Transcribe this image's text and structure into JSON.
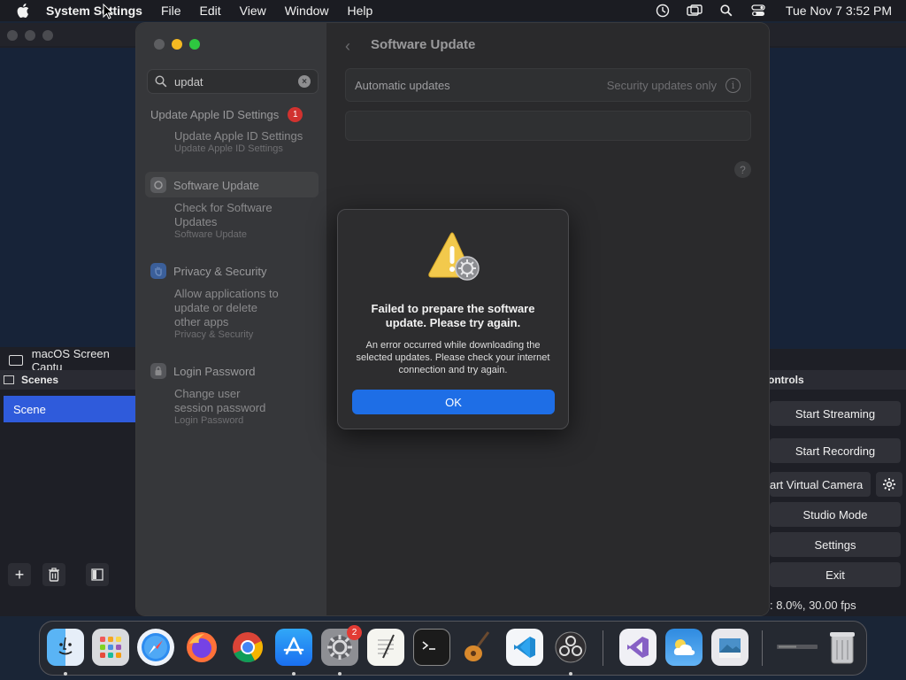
{
  "menubar": {
    "app": "System Settings",
    "menus": [
      "File",
      "Edit",
      "View",
      "Window",
      "Help"
    ],
    "clock": "Tue Nov 7  3:52 PM",
    "status_icons": [
      "screen-time-icon",
      "display-icon",
      "search-icon",
      "control-center-icon"
    ]
  },
  "obs": {
    "source_label": "macOS Screen Captu",
    "scenes_header": "Scenes",
    "scene_item": "Scene",
    "controls_header": "ontrols",
    "buttons": {
      "start_streaming": "Start Streaming",
      "start_recording": "Start Recording",
      "virtual_camera": "art Virtual Camera",
      "studio_mode": "Studio Mode",
      "settings": "Settings",
      "exit": "Exit"
    },
    "status": ": 8.0%, 30.00 fps"
  },
  "settings": {
    "search_value": "updat",
    "sidebar": {
      "apple_id": {
        "heading": "Update Apple ID Settings",
        "badge": "1",
        "sub": "Update Apple ID Settings",
        "sub2": "Update Apple ID Settings"
      },
      "software_update": {
        "heading": "Software Update",
        "sub": "Check for Software Updates",
        "sub2": "Software Update"
      },
      "privacy": {
        "heading": "Privacy & Security",
        "sub": "Allow applications to update or delete other apps",
        "sub2": "Privacy & Security"
      },
      "login": {
        "heading": "Login Password",
        "sub": "Change user session password",
        "sub2": "Login Password"
      }
    },
    "content": {
      "title": "Software Update",
      "auto_label": "Automatic updates",
      "auto_value": "Security updates only",
      "help": "?"
    }
  },
  "dialog": {
    "heading": "Failed to prepare the software update. Please try again.",
    "message": "An error occurred while downloading the selected updates. Please check your internet connection and try again.",
    "ok": "OK"
  },
  "dock": {
    "settings_badge": "2"
  }
}
